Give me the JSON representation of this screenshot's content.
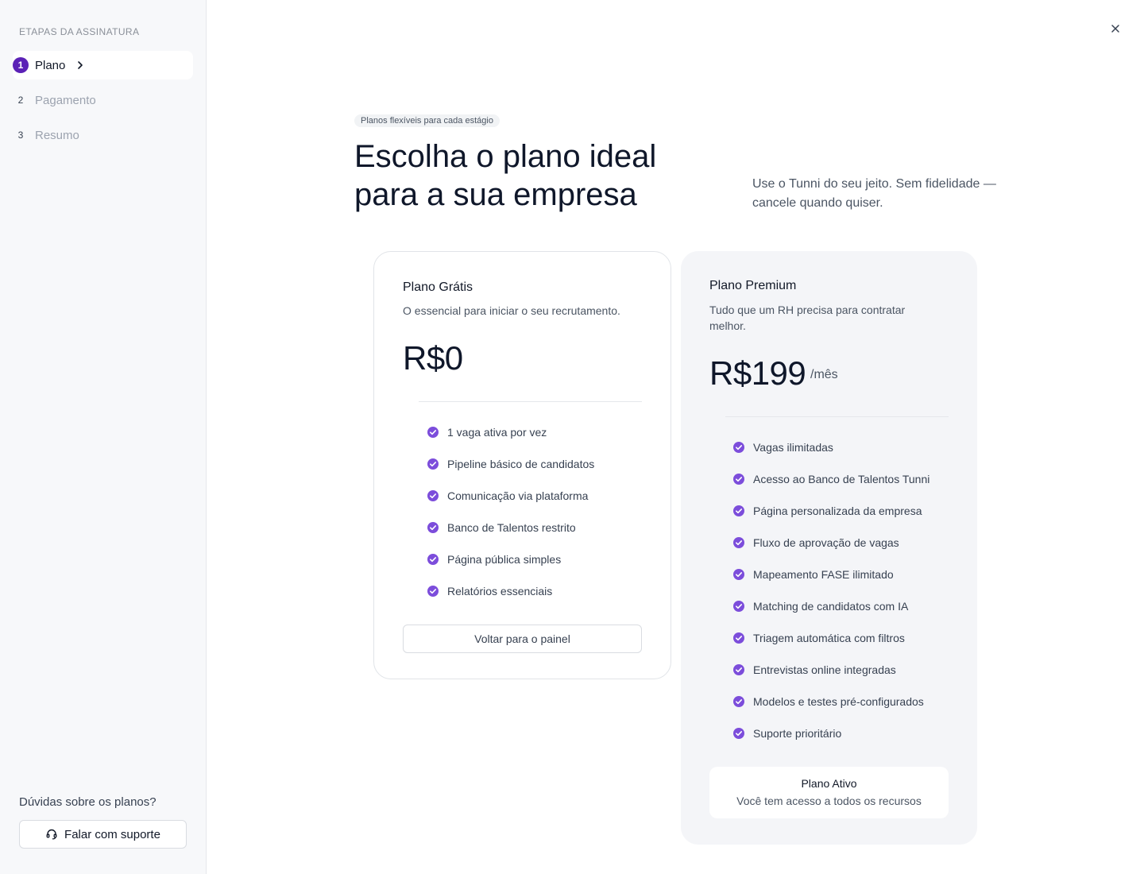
{
  "sidebar": {
    "title": "ETAPAS DA ASSINATURA",
    "steps": [
      {
        "number": "1",
        "label": "Plano",
        "active": true
      },
      {
        "number": "2",
        "label": "Pagamento",
        "active": false
      },
      {
        "number": "3",
        "label": "Resumo",
        "active": false
      }
    ],
    "help_text": "Dúvidas sobre os planos?",
    "support_button": "Falar com suporte"
  },
  "header": {
    "pill": "Planos flexíveis para cada estágio",
    "title_line1": "Escolha o plano ideal",
    "title_line2": "para a sua empresa",
    "subtitle": "Use o Tunni do seu jeito. Sem fidelidade — cancele quando quiser."
  },
  "plans": {
    "free": {
      "name": "Plano Grátis",
      "description": "O essencial para iniciar o seu recrutamento.",
      "price": "R$0",
      "features": [
        "1 vaga ativa por vez",
        "Pipeline básico de candidatos",
        "Comunicação via plataforma",
        "Banco de Talentos restrito",
        "Página pública simples",
        "Relatórios essenciais"
      ],
      "button": "Voltar para o painel"
    },
    "premium": {
      "name": "Plano Premium",
      "description": "Tudo que um RH precisa para contratar melhor.",
      "price": "R$199",
      "period": "/mês",
      "features": [
        "Vagas ilimitadas",
        "Acesso ao Banco de Talentos Tunni",
        "Página personalizada da empresa",
        "Fluxo de aprovação de vagas",
        "Mapeamento FASE ilimitado",
        "Matching de candidatos com IA",
        "Triagem automática com filtros",
        "Entrevistas online integradas",
        "Modelos e testes pré-configurados",
        "Suporte prioritário"
      ],
      "status_title": "Plano Ativo",
      "status_subtitle": "Você tem acesso a todos os recursos"
    }
  },
  "colors": {
    "accent": "#5b21b6",
    "check": "#7c4ddb"
  },
  "icons": {
    "close": "close-icon",
    "chevron": "chevron-right-icon",
    "support": "headset-icon",
    "check": "check-circle-icon"
  }
}
